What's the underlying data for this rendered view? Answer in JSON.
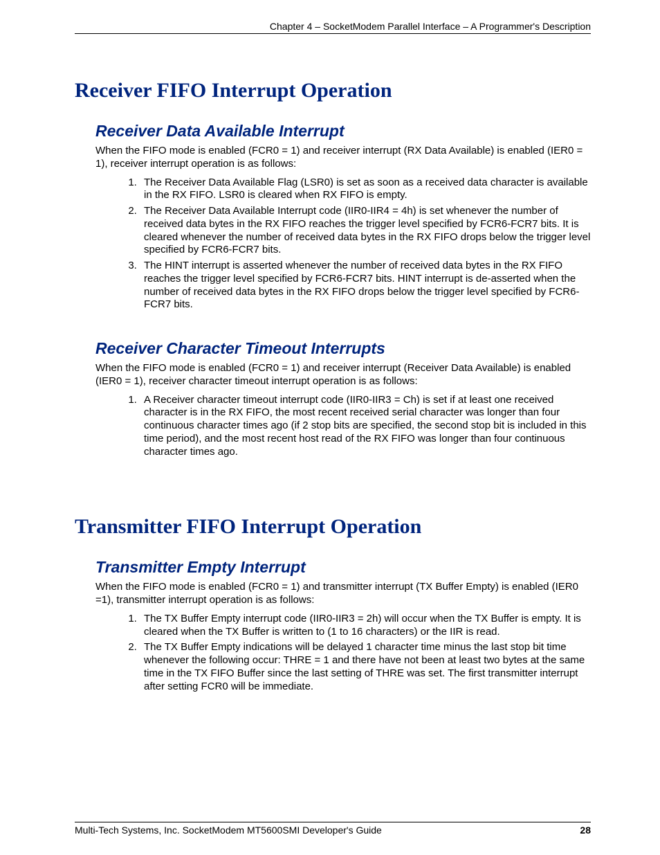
{
  "header": {
    "text": "Chapter 4 – SocketModem Parallel Interface – A Programmer's Description"
  },
  "section1": {
    "title": "Receiver FIFO Interrupt Operation",
    "sub1": {
      "title": "Receiver Data Available Interrupt",
      "intro": "When the FIFO mode is enabled (FCR0 = 1) and receiver interrupt (RX Data Available) is enabled (IER0 = 1), receiver interrupt operation is as follows:",
      "items": [
        "The Receiver Data Available Flag (LSR0) is set as soon as a received data character is available in the RX FIFO. LSR0 is cleared when RX FIFO is empty.",
        "The Receiver Data Available Interrupt code (IIR0-IIR4 = 4h) is set whenever the number of received data bytes in the RX FIFO reaches the trigger level specified by FCR6-FCR7 bits. It is cleared whenever the number of received data bytes in the RX FIFO drops below the trigger level specified by FCR6-FCR7 bits.",
        "The HINT interrupt is asserted whenever the number of received data bytes in the RX FIFO reaches the trigger level specified by FCR6-FCR7 bits. HINT interrupt is de-asserted when the number of received data bytes in the RX FIFO drops below the trigger level specified by FCR6-FCR7 bits."
      ]
    },
    "sub2": {
      "title": "Receiver Character Timeout Interrupts",
      "intro": "When the FIFO mode is enabled (FCR0 = 1) and receiver interrupt (Receiver Data Available) is enabled (IER0 = 1), receiver character timeout interrupt operation is as follows:",
      "items": [
        "A Receiver character timeout interrupt code (IIR0-IIR3 = Ch) is set if at least one received character is in the RX FIFO, the most recent received serial character was longer than four continuous character times ago (if 2 stop bits are specified, the second stop bit is included in this time period), and the most recent host read of the RX FIFO was longer than four continuous character times ago."
      ]
    }
  },
  "section2": {
    "title": "Transmitter FIFO Interrupt Operation",
    "sub1": {
      "title": "Transmitter Empty Interrupt",
      "intro": "When the FIFO mode is enabled (FCR0 = 1) and transmitter interrupt (TX Buffer Empty) is enabled (IER0 =1), transmitter interrupt operation is as follows:",
      "items": [
        "The TX Buffer Empty interrupt code (IIR0-IIR3 = 2h) will occur when the TX Buffer is empty. It is cleared when the TX Buffer is written to (1 to 16 characters) or the IIR is read.",
        "The TX Buffer Empty indications will be delayed 1 character time minus the last stop bit time whenever the following occur: THRE = 1 and there have not been at least two bytes at the same time in the TX FIFO Buffer since the last setting of THRE was set. The first transmitter interrupt after setting FCR0 will be immediate."
      ]
    }
  },
  "footer": {
    "text": "Multi-Tech Systems, Inc. SocketModem MT5600SMI Developer's Guide",
    "page": "28"
  }
}
